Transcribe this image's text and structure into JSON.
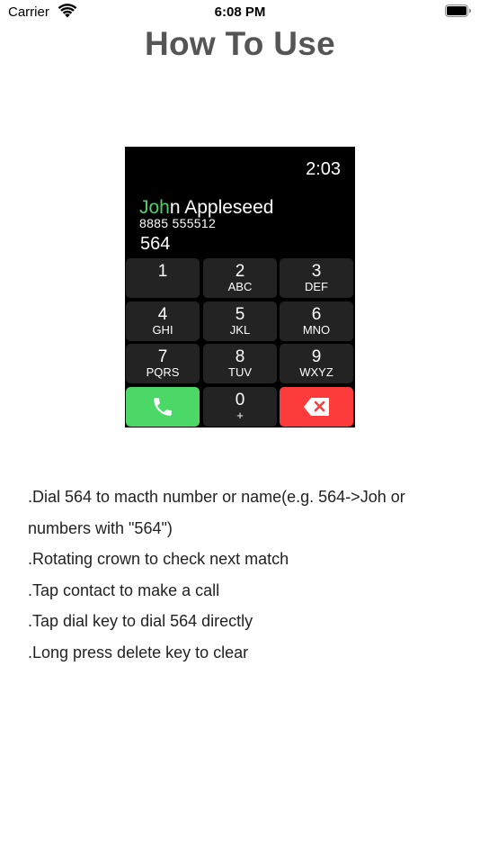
{
  "status_bar": {
    "carrier": "Carrier",
    "time": "6:08 PM",
    "icons": [
      "wifi-icon",
      "battery-icon"
    ]
  },
  "page": {
    "title": "How To Use"
  },
  "watch_preview": {
    "time": "2:03",
    "contact": {
      "name_match": "Joh",
      "name_rest": "n Appleseed",
      "number": "8885 555512"
    },
    "dialed": "564",
    "keys": [
      {
        "digit": "1",
        "letters": ""
      },
      {
        "digit": "2",
        "letters": "ABC"
      },
      {
        "digit": "3",
        "letters": "DEF"
      },
      {
        "digit": "4",
        "letters": "GHI"
      },
      {
        "digit": "5",
        "letters": "JKL"
      },
      {
        "digit": "6",
        "letters": "MNO"
      },
      {
        "digit": "7",
        "letters": "PQRS"
      },
      {
        "digit": "8",
        "letters": "TUV"
      },
      {
        "digit": "9",
        "letters": "WXYZ"
      },
      {
        "digit": "0",
        "letters": "+"
      }
    ],
    "colors": {
      "match": "#4cd06b",
      "call": "#4cd866",
      "delete": "#fe3b3b",
      "key": "#232323"
    },
    "icons": {
      "call": "phone-icon",
      "delete": "backspace-icon"
    }
  },
  "instructions": [
    ".Dial 564 to macth number or name(e.g. 564->Joh or numbers with \"564\")",
    ".Rotating crown to check next match",
    ".Tap contact to make a call",
    ".Tap dial key to dial 564 directly",
    ".Long press delete key to clear"
  ]
}
